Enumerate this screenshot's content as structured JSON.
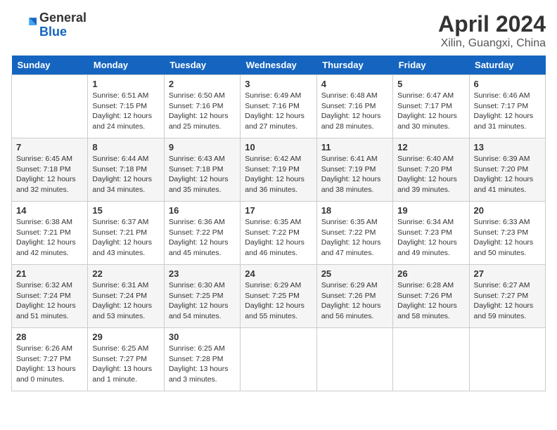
{
  "header": {
    "logo_general": "General",
    "logo_blue": "Blue",
    "month_title": "April 2024",
    "subtitle": "Xilin, Guangxi, China"
  },
  "weekdays": [
    "Sunday",
    "Monday",
    "Tuesday",
    "Wednesday",
    "Thursday",
    "Friday",
    "Saturday"
  ],
  "weeks": [
    [
      {
        "day": "",
        "info": ""
      },
      {
        "day": "1",
        "info": "Sunrise: 6:51 AM\nSunset: 7:15 PM\nDaylight: 12 hours and 24 minutes."
      },
      {
        "day": "2",
        "info": "Sunrise: 6:50 AM\nSunset: 7:16 PM\nDaylight: 12 hours and 25 minutes."
      },
      {
        "day": "3",
        "info": "Sunrise: 6:49 AM\nSunset: 7:16 PM\nDaylight: 12 hours and 27 minutes."
      },
      {
        "day": "4",
        "info": "Sunrise: 6:48 AM\nSunset: 7:16 PM\nDaylight: 12 hours and 28 minutes."
      },
      {
        "day": "5",
        "info": "Sunrise: 6:47 AM\nSunset: 7:17 PM\nDaylight: 12 hours and 30 minutes."
      },
      {
        "day": "6",
        "info": "Sunrise: 6:46 AM\nSunset: 7:17 PM\nDaylight: 12 hours and 31 minutes."
      }
    ],
    [
      {
        "day": "7",
        "info": "Sunrise: 6:45 AM\nSunset: 7:18 PM\nDaylight: 12 hours and 32 minutes."
      },
      {
        "day": "8",
        "info": "Sunrise: 6:44 AM\nSunset: 7:18 PM\nDaylight: 12 hours and 34 minutes."
      },
      {
        "day": "9",
        "info": "Sunrise: 6:43 AM\nSunset: 7:18 PM\nDaylight: 12 hours and 35 minutes."
      },
      {
        "day": "10",
        "info": "Sunrise: 6:42 AM\nSunset: 7:19 PM\nDaylight: 12 hours and 36 minutes."
      },
      {
        "day": "11",
        "info": "Sunrise: 6:41 AM\nSunset: 7:19 PM\nDaylight: 12 hours and 38 minutes."
      },
      {
        "day": "12",
        "info": "Sunrise: 6:40 AM\nSunset: 7:20 PM\nDaylight: 12 hours and 39 minutes."
      },
      {
        "day": "13",
        "info": "Sunrise: 6:39 AM\nSunset: 7:20 PM\nDaylight: 12 hours and 41 minutes."
      }
    ],
    [
      {
        "day": "14",
        "info": "Sunrise: 6:38 AM\nSunset: 7:21 PM\nDaylight: 12 hours and 42 minutes."
      },
      {
        "day": "15",
        "info": "Sunrise: 6:37 AM\nSunset: 7:21 PM\nDaylight: 12 hours and 43 minutes."
      },
      {
        "day": "16",
        "info": "Sunrise: 6:36 AM\nSunset: 7:22 PM\nDaylight: 12 hours and 45 minutes."
      },
      {
        "day": "17",
        "info": "Sunrise: 6:35 AM\nSunset: 7:22 PM\nDaylight: 12 hours and 46 minutes."
      },
      {
        "day": "18",
        "info": "Sunrise: 6:35 AM\nSunset: 7:22 PM\nDaylight: 12 hours and 47 minutes."
      },
      {
        "day": "19",
        "info": "Sunrise: 6:34 AM\nSunset: 7:23 PM\nDaylight: 12 hours and 49 minutes."
      },
      {
        "day": "20",
        "info": "Sunrise: 6:33 AM\nSunset: 7:23 PM\nDaylight: 12 hours and 50 minutes."
      }
    ],
    [
      {
        "day": "21",
        "info": "Sunrise: 6:32 AM\nSunset: 7:24 PM\nDaylight: 12 hours and 51 minutes."
      },
      {
        "day": "22",
        "info": "Sunrise: 6:31 AM\nSunset: 7:24 PM\nDaylight: 12 hours and 53 minutes."
      },
      {
        "day": "23",
        "info": "Sunrise: 6:30 AM\nSunset: 7:25 PM\nDaylight: 12 hours and 54 minutes."
      },
      {
        "day": "24",
        "info": "Sunrise: 6:29 AM\nSunset: 7:25 PM\nDaylight: 12 hours and 55 minutes."
      },
      {
        "day": "25",
        "info": "Sunrise: 6:29 AM\nSunset: 7:26 PM\nDaylight: 12 hours and 56 minutes."
      },
      {
        "day": "26",
        "info": "Sunrise: 6:28 AM\nSunset: 7:26 PM\nDaylight: 12 hours and 58 minutes."
      },
      {
        "day": "27",
        "info": "Sunrise: 6:27 AM\nSunset: 7:27 PM\nDaylight: 12 hours and 59 minutes."
      }
    ],
    [
      {
        "day": "28",
        "info": "Sunrise: 6:26 AM\nSunset: 7:27 PM\nDaylight: 13 hours and 0 minutes."
      },
      {
        "day": "29",
        "info": "Sunrise: 6:25 AM\nSunset: 7:27 PM\nDaylight: 13 hours and 1 minute."
      },
      {
        "day": "30",
        "info": "Sunrise: 6:25 AM\nSunset: 7:28 PM\nDaylight: 13 hours and 3 minutes."
      },
      {
        "day": "",
        "info": ""
      },
      {
        "day": "",
        "info": ""
      },
      {
        "day": "",
        "info": ""
      },
      {
        "day": "",
        "info": ""
      }
    ]
  ]
}
